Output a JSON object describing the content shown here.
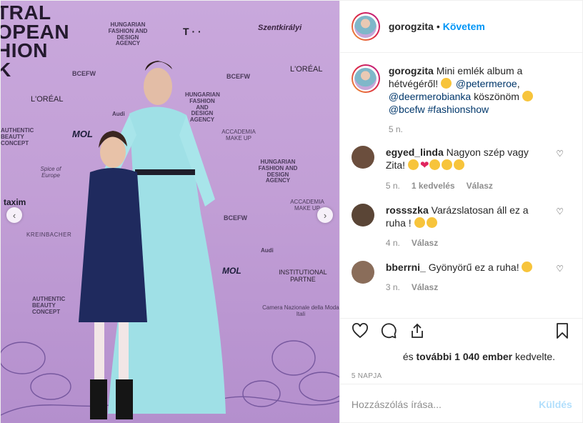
{
  "photo": {
    "backdrop_words": {
      "big": [
        "TRAL",
        "OPEAN",
        "HION",
        "K"
      ],
      "hungarian_fashion": "HUNGARIAN FASHION AND DESIGN AGENCY",
      "bcefw": "BCEFW",
      "loreal": "L'ORÉAL",
      "audi": "Audi",
      "mol": "MOL",
      "taxim": "taxim",
      "authentic": "AUTHENTIC BEAUTY CONCEPT",
      "accademia": "ACCADEMIA MAKE UP",
      "institutional": "INSTITUTIONAL PARTNE",
      "camera": "Camera Nazionale della Moda Itali",
      "kreinbacher": "KREINBACHER",
      "spice": "Spice of Europe",
      "szentkiraly": "Szentkirályi",
      "makeup": "MAKE UP",
      "t": "T · ·"
    },
    "prev_label": "‹",
    "next_label": "›"
  },
  "header": {
    "username": "gorogzita",
    "dot": "•",
    "follow_label": "Követem"
  },
  "caption": {
    "username": "gorogzita",
    "text_1": "Mini emlék album a hétvégéről!",
    "mention_1": "@petermeroe",
    "sep": ",",
    "mention_2": "@deermerobianka",
    "text_2": "köszönöm",
    "mention_3": "@bcefw",
    "hashtag": "#fashionshow",
    "time": "5 n."
  },
  "comments": [
    {
      "username": "egyed_linda",
      "text": "Nagyon szép vagy Zita!",
      "time": "5 n.",
      "likes": "1 kedvelés",
      "reply": "Válasz",
      "avatar_color": "#6b4e3d"
    },
    {
      "username": "rossszka",
      "text": "Varázslatosan áll ez a ruha !",
      "time": "4 n.",
      "likes": "",
      "reply": "Válasz",
      "avatar_color": "#5a4536"
    },
    {
      "username": "bberrni_",
      "text": "Gyönyörű ez a ruha!",
      "time": "3 n.",
      "likes": "",
      "reply": "Válasz",
      "avatar_color": "#8a6d5a"
    }
  ],
  "actions": {
    "like_icon": "heart-icon",
    "comment_icon": "comment-icon",
    "share_icon": "share-icon",
    "save_icon": "bookmark-icon"
  },
  "likes": {
    "and": "és",
    "count_text": "további 1 040 ember",
    "suffix": "kedvelte."
  },
  "posted": "5 NAPJA",
  "add_comment": {
    "placeholder": "Hozzászólás írása...",
    "send_label": "Küldés"
  },
  "colors": {
    "accent": "#0095f6",
    "link": "#00376b",
    "muted": "#8e8e8e",
    "backdrop": "#c29fd6",
    "dress": "#9fe0e6",
    "send_disabled": "#b2dffc"
  }
}
